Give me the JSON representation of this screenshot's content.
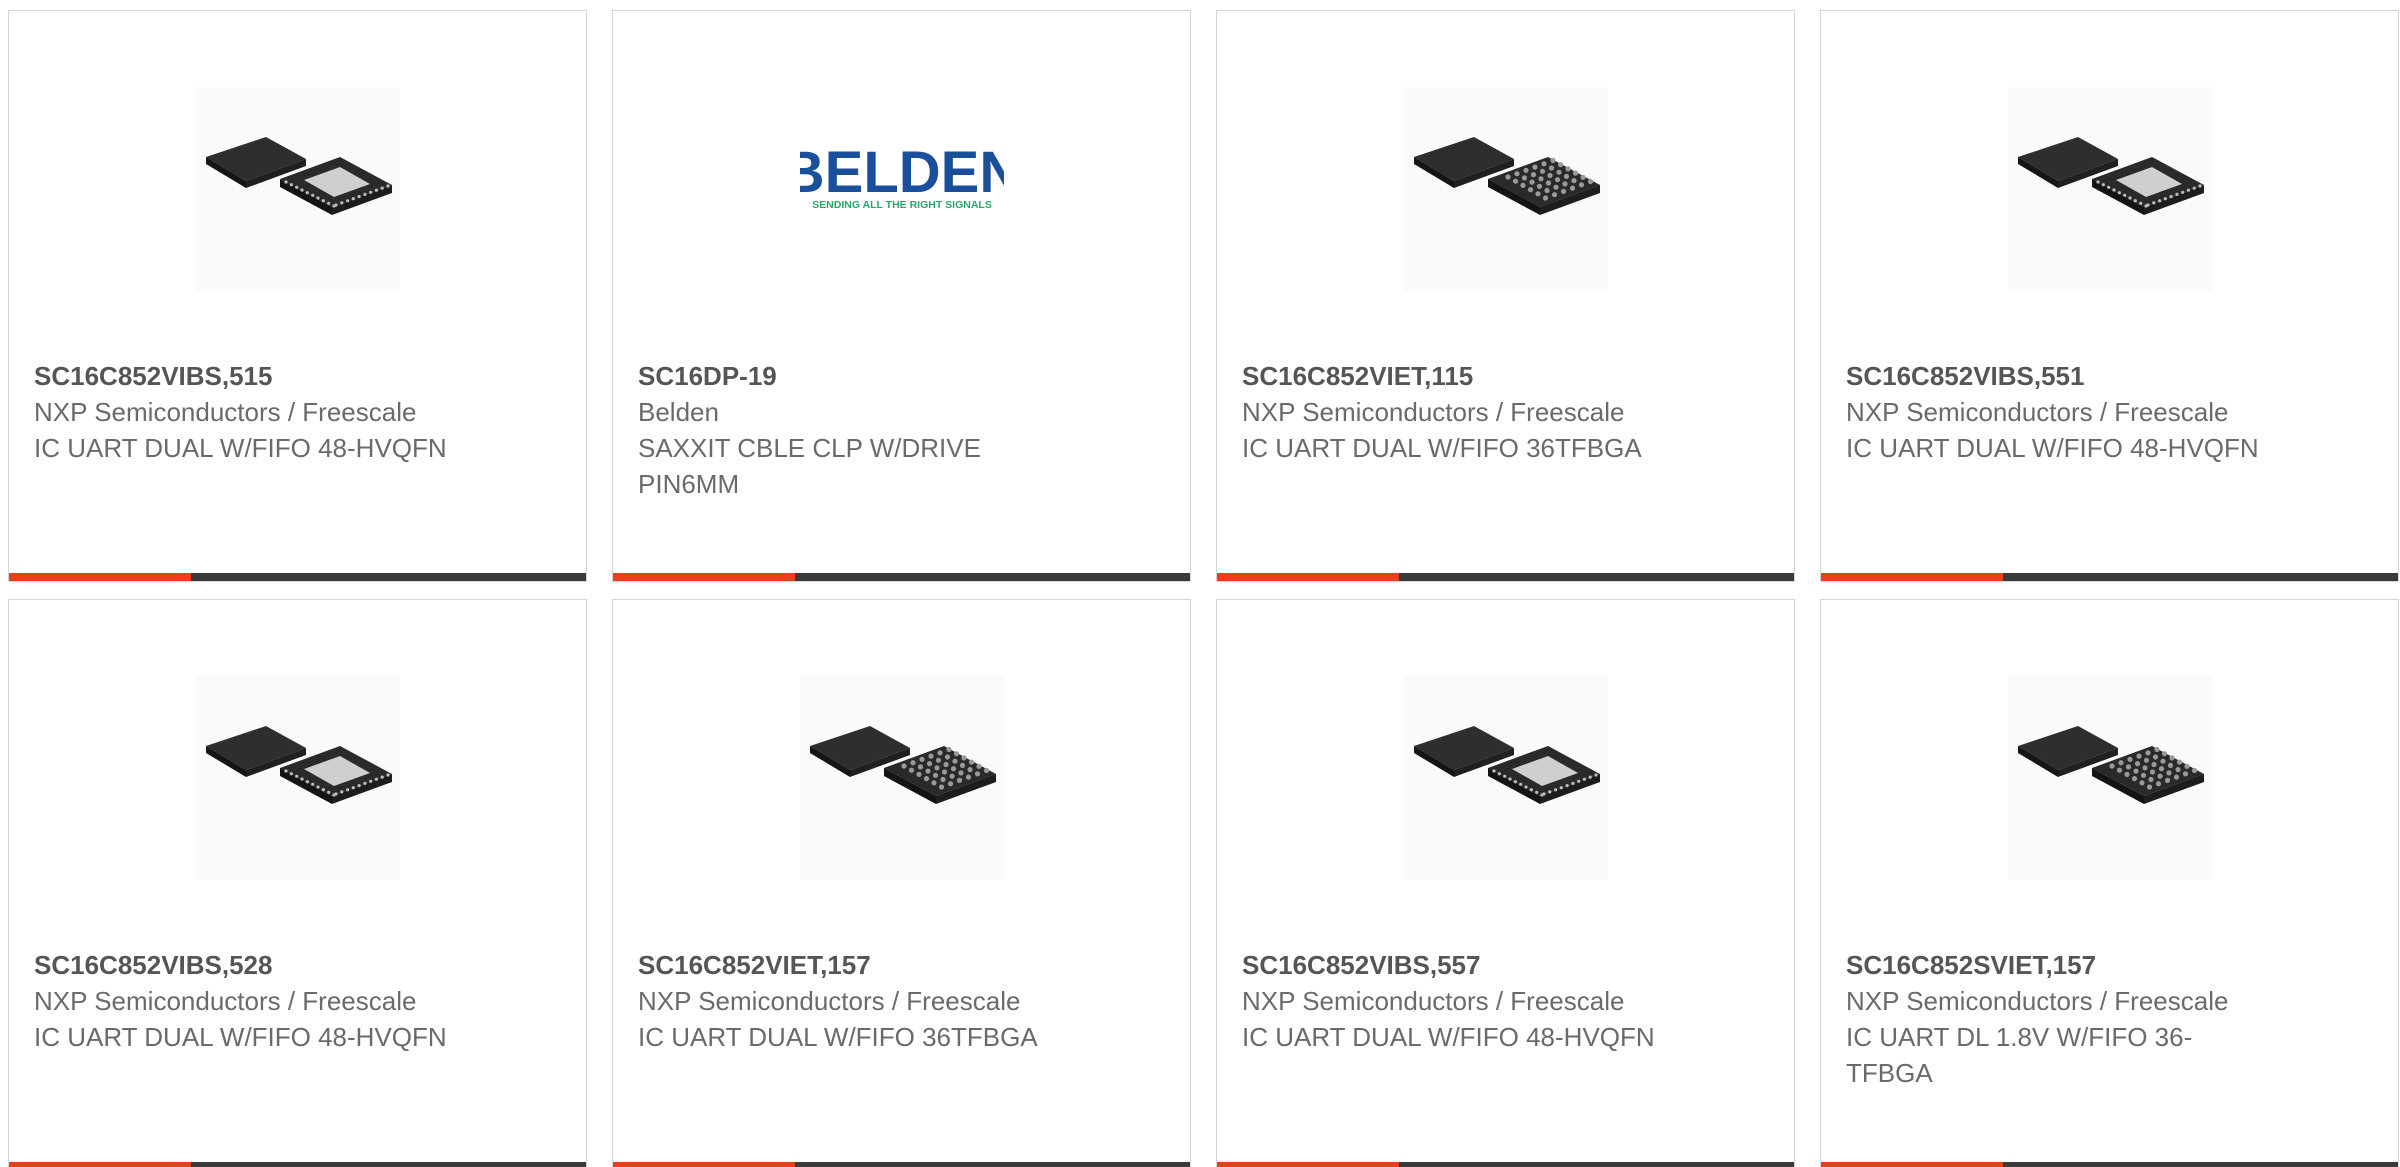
{
  "colors": {
    "accent": "#e8401c",
    "bar_dark": "#3a3a3a",
    "card_border": "#d6d6d6",
    "part_text": "#555555",
    "body_text": "#6a6a6a",
    "belden_blue": "#1a4f9c",
    "belden_green": "#2aa86b"
  },
  "products": [
    {
      "part_number": "SC16C852VIBS,515",
      "manufacturer": "NXP Semiconductors / Freescale",
      "description": "IC UART DUAL W/FIFO 48-HVQFN",
      "image": "hvqfn-chip-icon"
    },
    {
      "part_number": "SC16DP-19",
      "manufacturer": "Belden",
      "description": "SAXXIT CBLE CLP W/DRIVE PIN6MM",
      "image": "belden-logo",
      "logo_text": "BELDEN",
      "logo_tagline": "SENDING ALL THE RIGHT SIGNALS"
    },
    {
      "part_number": "SC16C852VIET,115",
      "manufacturer": "NXP Semiconductors / Freescale",
      "description": "IC UART DUAL W/FIFO 36TFBGA",
      "image": "tfbga-chip-icon"
    },
    {
      "part_number": "SC16C852VIBS,551",
      "manufacturer": "NXP Semiconductors / Freescale",
      "description": "IC UART DUAL W/FIFO 48-HVQFN",
      "image": "hvqfn-chip-icon"
    },
    {
      "part_number": "SC16C852VIBS,528",
      "manufacturer": "NXP Semiconductors / Freescale",
      "description": "IC UART DUAL W/FIFO 48-HVQFN",
      "image": "hvqfn-chip-icon"
    },
    {
      "part_number": "SC16C852VIET,157",
      "manufacturer": "NXP Semiconductors / Freescale",
      "description": "IC UART DUAL W/FIFO 36TFBGA",
      "image": "tfbga-chip-icon"
    },
    {
      "part_number": "SC16C852VIBS,557",
      "manufacturer": "NXP Semiconductors / Freescale",
      "description": "IC UART DUAL W/FIFO 48-HVQFN",
      "image": "hvqfn-chip-icon"
    },
    {
      "part_number": "SC16C852SVIET,157",
      "manufacturer": "NXP Semiconductors / Freescale",
      "description": "IC UART DL 1.8V W/FIFO 36-TFBGA",
      "image": "tfbga-chip-icon"
    }
  ]
}
